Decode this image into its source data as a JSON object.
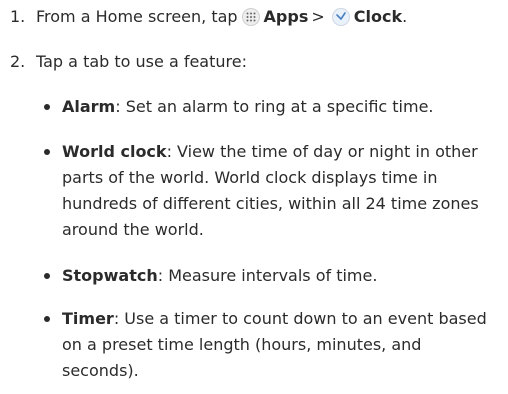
{
  "steps": [
    {
      "number": "1.",
      "text_before": "From a Home screen, tap",
      "apps_icon": "apps-grid-icon",
      "apps_label": "Apps",
      "separator": ">",
      "clock_icon": "clock-app-icon",
      "clock_label": "Clock",
      "text_after": "."
    },
    {
      "number": "2.",
      "text": "Tap a tab to use a feature:"
    }
  ],
  "features": [
    {
      "name": "Alarm",
      "description": ": Set an alarm to ring at a specific time."
    },
    {
      "name": "World clock",
      "description": ": View the time of day or night in other parts of the world. World clock displays time in hundreds of different cities, within all 24 time zones around the world."
    },
    {
      "name": "Stopwatch",
      "description": ": Measure intervals of time."
    },
    {
      "name": "Timer",
      "description": ": Use a timer to count down to an event based on a preset time length (hours, minutes, and seconds)."
    }
  ]
}
